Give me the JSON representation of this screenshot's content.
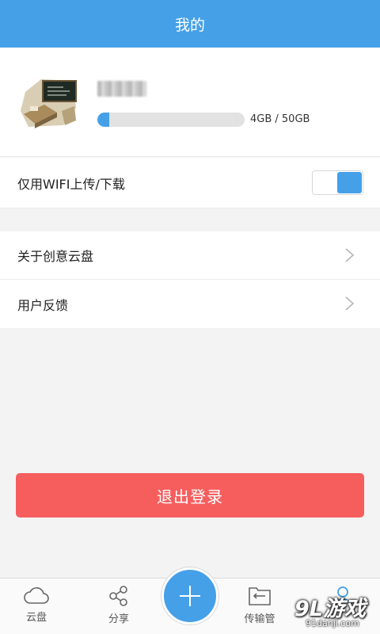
{
  "header": {
    "title": "我的"
  },
  "profile": {
    "storage": {
      "used_label": "4GB / 50GB",
      "used_fraction": 0.08
    }
  },
  "settings": {
    "wifi_only": {
      "label": "仅用WIFI上传/下载",
      "enabled": true
    }
  },
  "menu": [
    {
      "label": "关于创意云盘"
    },
    {
      "label": "用户反馈"
    }
  ],
  "logout": {
    "label": "退出登录"
  },
  "tabbar": {
    "tabs": [
      {
        "label": "云盘",
        "icon": "cloud-icon"
      },
      {
        "label": "分享",
        "icon": "share-icon"
      },
      {
        "label": "传输管",
        "icon": "transfer-icon"
      },
      {
        "label": "我的",
        "icon": "user-icon"
      }
    ],
    "fab_icon": "plus-icon"
  },
  "watermark": {
    "main": "9L游戏",
    "sub": "91danji.com"
  },
  "colors": {
    "accent": "#45a0e8",
    "danger": "#f65e5e",
    "background": "#f3f3f3"
  }
}
